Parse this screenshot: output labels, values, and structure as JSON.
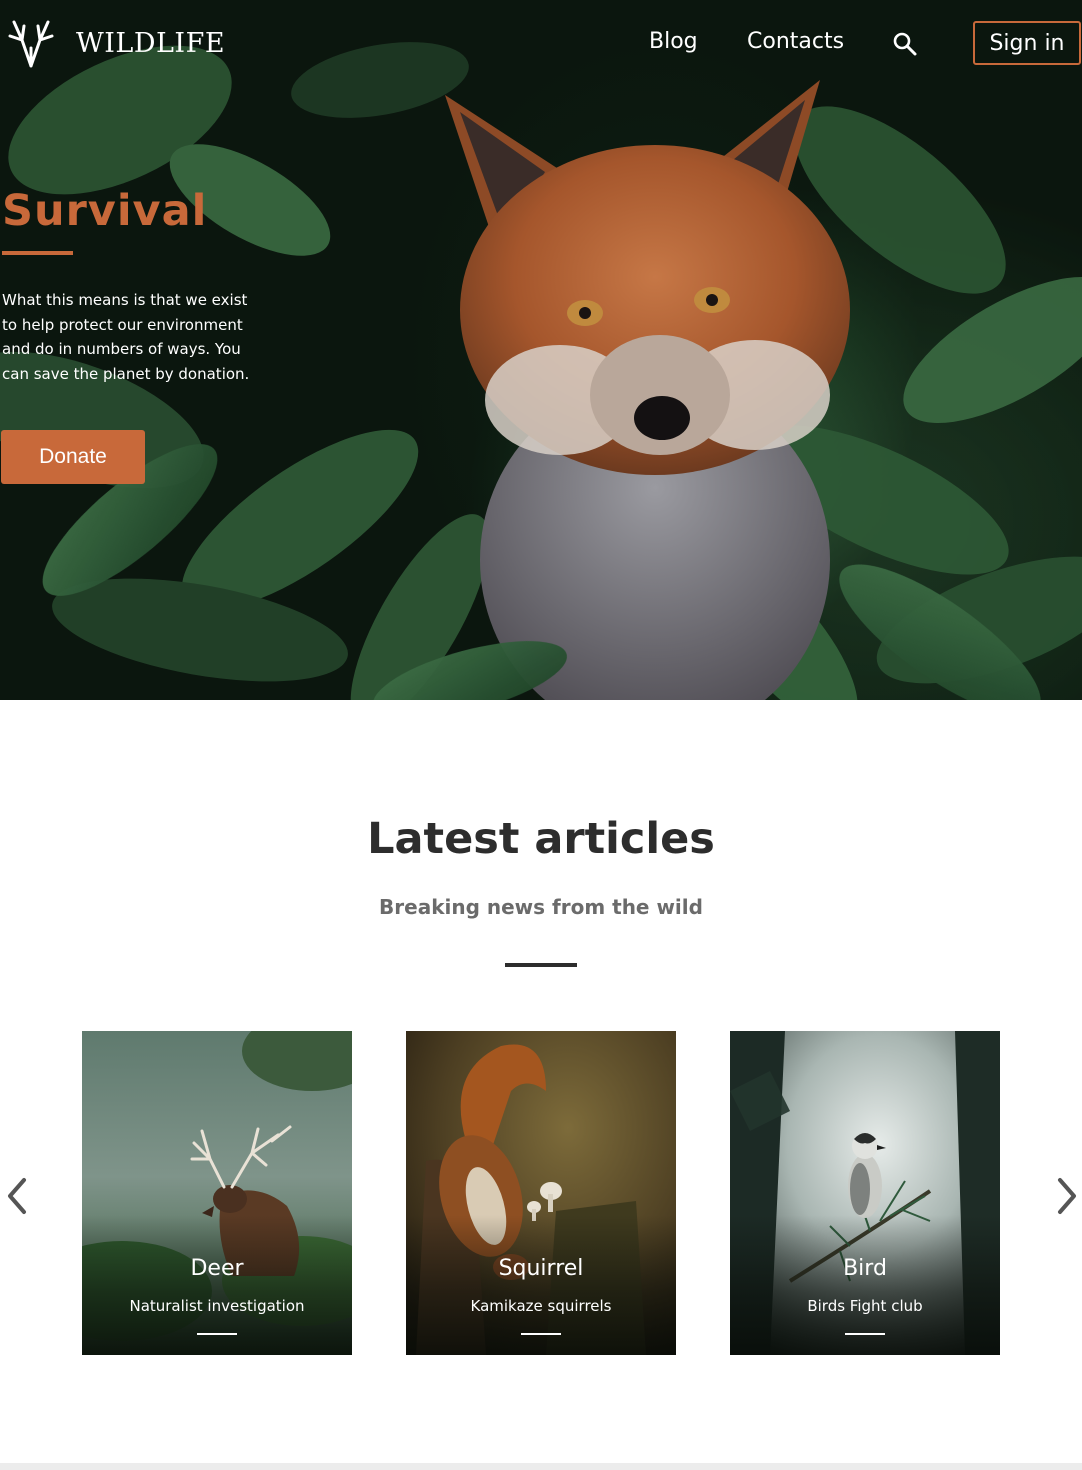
{
  "header": {
    "logo_text": "WILDLIFE",
    "nav": {
      "blog": "Blog",
      "contacts": "Contacts"
    },
    "signin_label": "Sign in"
  },
  "hero": {
    "title": "Survival",
    "text": "What this means is that we exist to help protect our environment and do in numbers of ways. You can save the planet by donation.",
    "donate_label": "Donate"
  },
  "articles": {
    "title": "Latest articles",
    "subtitle": "Breaking news from the wild",
    "cards": [
      {
        "title": "Deer",
        "subtitle": "Naturalist investigation"
      },
      {
        "title": "Squirrel",
        "subtitle": "Kamikaze squirrels"
      },
      {
        "title": "Bird",
        "subtitle": "Birds Fight club"
      }
    ]
  },
  "colors": {
    "accent": "#c8693a",
    "heading": "#2d2d2d",
    "subheading": "#6b6b6b"
  },
  "icons": {
    "logo": "antlers-icon",
    "search": "search-icon",
    "prev": "chevron-left-icon",
    "next": "chevron-right-icon"
  }
}
